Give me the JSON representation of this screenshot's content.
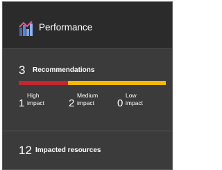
{
  "header": {
    "title": "Performance",
    "icon": "performance-chart-icon"
  },
  "recommendations": {
    "count": "3",
    "label": "Recommendations",
    "bar": {
      "high_fraction": 0.333,
      "medium_fraction": 0.667,
      "low_fraction": 0,
      "high_color": "#c4262e",
      "medium_color": "#f2b900",
      "low_color": "#8a8a8a"
    },
    "impacts": [
      {
        "count": "1",
        "label": "High impact"
      },
      {
        "count": "2",
        "label": "Medium impact"
      },
      {
        "count": "0",
        "label": "Low impact"
      }
    ]
  },
  "impacted_resources": {
    "count": "12",
    "label": "Impacted resources"
  }
}
